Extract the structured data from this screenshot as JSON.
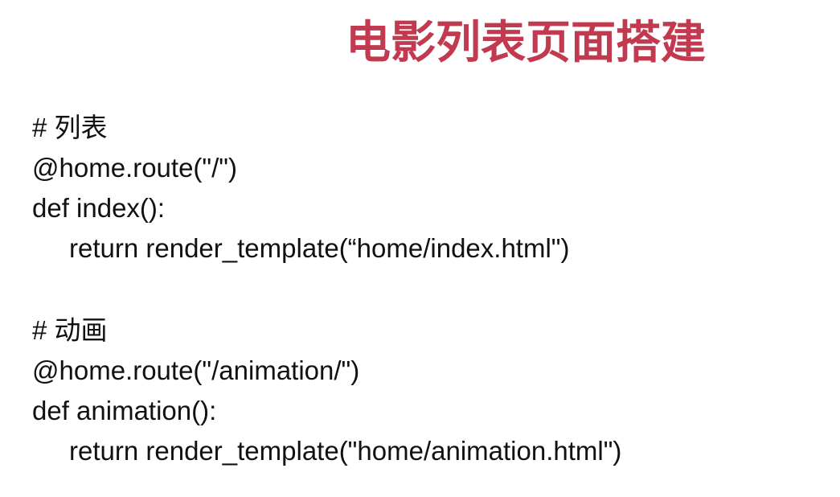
{
  "slide": {
    "title": "电影列表页面搭建"
  },
  "code": {
    "block1": {
      "comment": "# 列表",
      "decorator": "@home.route(\"/\")",
      "def": "def index():",
      "return": "return render_template(“home/index.html\")"
    },
    "block2": {
      "comment": "# 动画",
      "decorator": "@home.route(\"/animation/\")",
      "def": "def animation():",
      "return": "return render_template(\"home/animation.html\")"
    }
  }
}
